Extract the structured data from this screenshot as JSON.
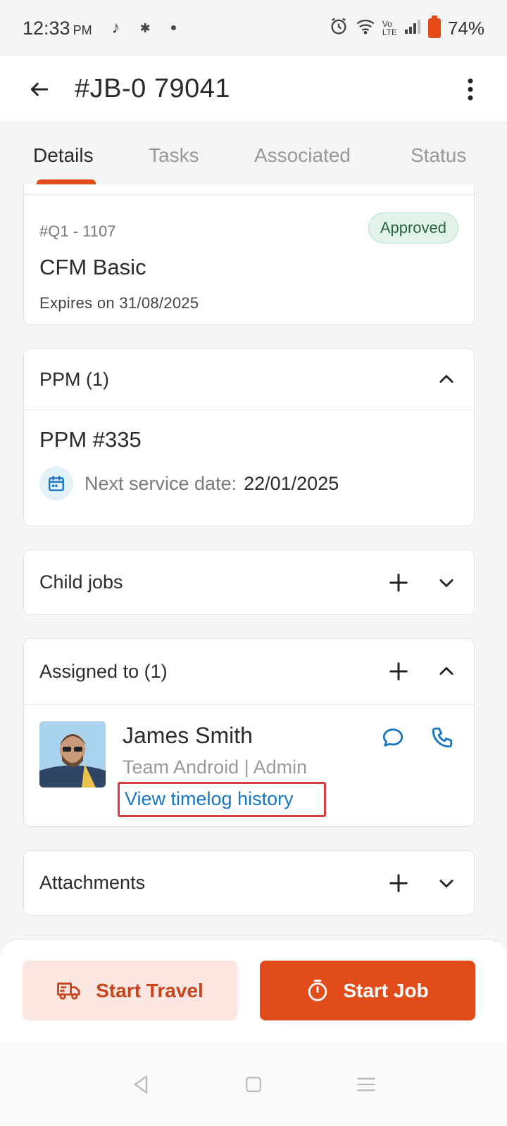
{
  "status_bar": {
    "time": "12:33",
    "ampm": "PM",
    "battery": "74%"
  },
  "header": {
    "title": "#JB-0 79041"
  },
  "tabs": [
    {
      "label": "Details",
      "active": true
    },
    {
      "label": "Tasks",
      "active": false
    },
    {
      "label": "Associated",
      "active": false
    },
    {
      "label": "Status",
      "active": false
    }
  ],
  "quote": {
    "number": "#Q1 - 1107",
    "status": "Approved",
    "name": "CFM Basic",
    "expiry": "Expires on 31/08/2025"
  },
  "ppm": {
    "header": "PPM (1)",
    "name": "PPM #335",
    "next_service_label": "Next service date:",
    "next_service_value": "22/01/2025"
  },
  "child_jobs": {
    "header": "Child jobs"
  },
  "assigned": {
    "header": "Assigned to (1)",
    "person": {
      "name": "James Smith",
      "role": "Team Android | Admin",
      "timelog_link": "View timelog history"
    }
  },
  "attachments": {
    "header": "Attachments"
  },
  "actions": {
    "travel_label": "Start Travel",
    "start_label": "Start Job"
  },
  "colors": {
    "accent": "#e24c1b",
    "link": "#1976c2",
    "approved_bg": "#e2f3ea",
    "approved_text": "#25643f"
  }
}
